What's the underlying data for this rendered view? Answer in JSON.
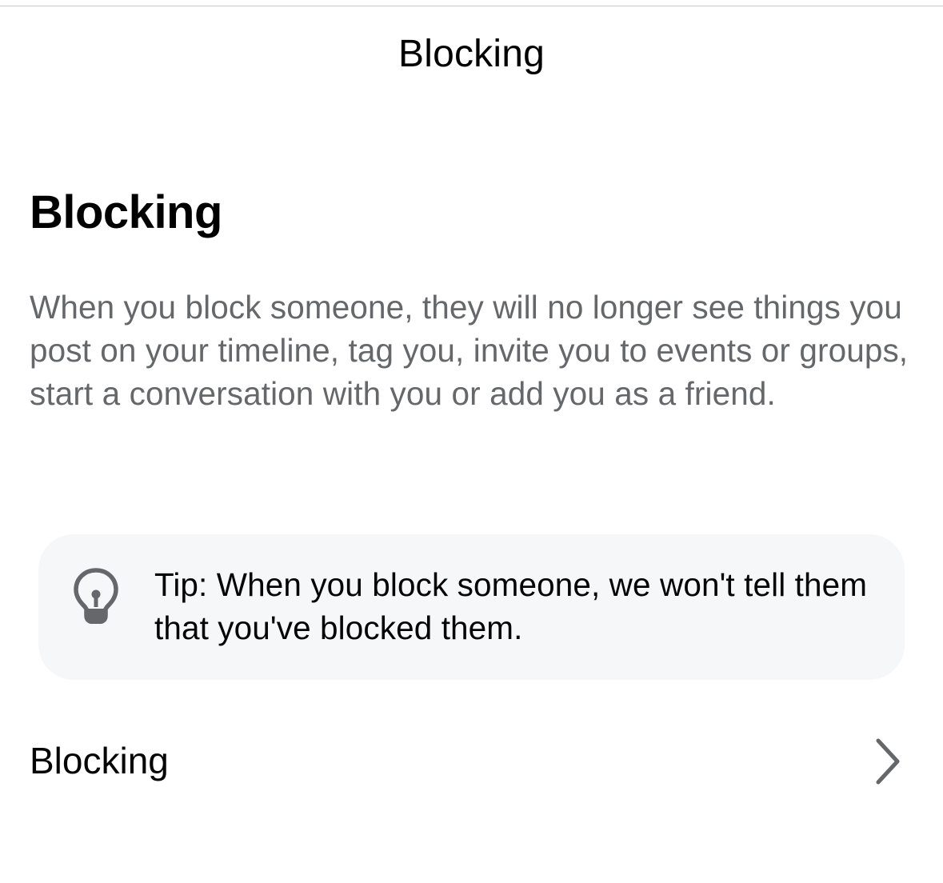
{
  "header": {
    "title": "Blocking"
  },
  "section": {
    "heading": "Blocking",
    "description": "When you block someone, they will no longer see things you post on your timeline, tag you, invite you to events or groups, start a conversation with you or add you as a friend."
  },
  "tip": {
    "icon": "lightbulb-icon",
    "text": "Tip: When you block someone, we won't tell them that you've blocked them."
  },
  "row": {
    "label": "Blocking",
    "icon": "chevron-right-icon"
  },
  "colors": {
    "secondary_text": "#65676b",
    "tip_background": "#f6f7f9",
    "icon_color": "#65676b"
  }
}
